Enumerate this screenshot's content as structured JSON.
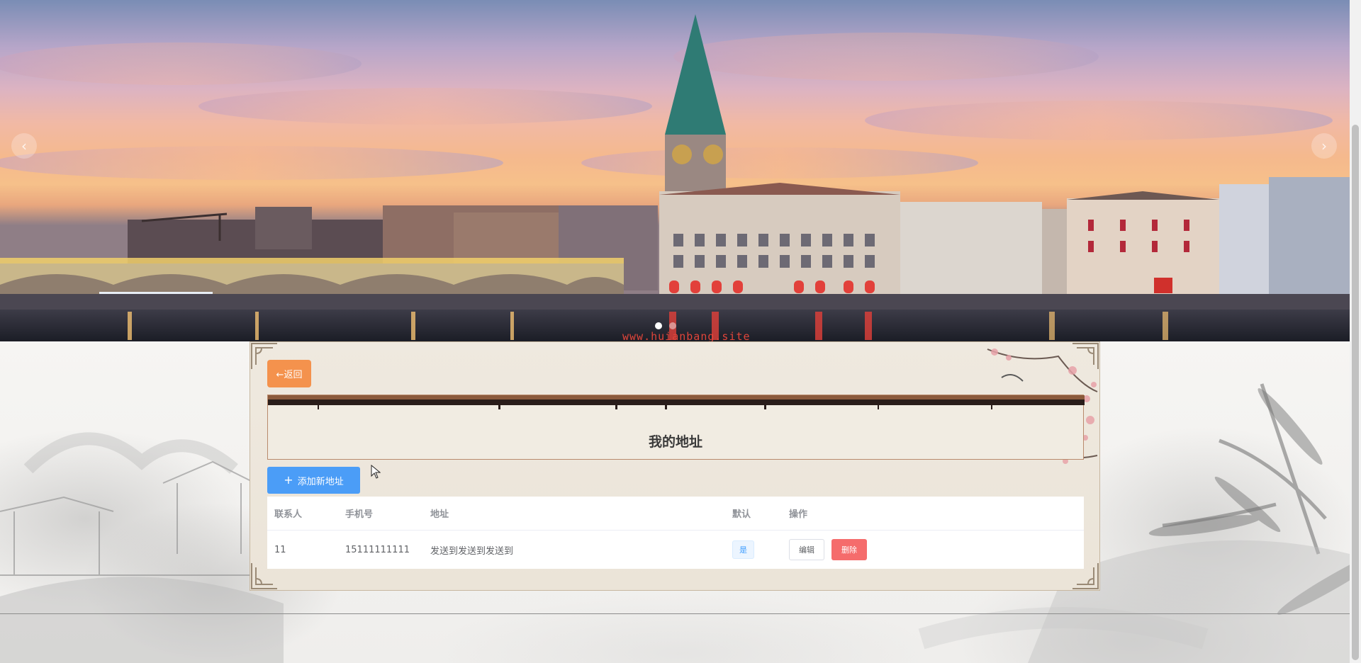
{
  "banner": {
    "watermark": "www.huianbang.site",
    "prev_arrow": "‹",
    "next_arrow": "›",
    "slide_count": 2,
    "active_slide": 1
  },
  "nav": {
    "back_label": "←返回"
  },
  "page": {
    "title": "我的地址",
    "add_button_label": "添加新地址",
    "add_button_icon": "plus-icon"
  },
  "table": {
    "headers": {
      "contact": "联系人",
      "phone": "手机号",
      "address": "地址",
      "default": "默认",
      "actions": "操作"
    },
    "rows": [
      {
        "contact": "11",
        "phone": "15111111111",
        "address": "发送到发送到发送到",
        "default": "是",
        "edit_label": "编辑",
        "delete_label": "删除"
      }
    ]
  },
  "colors": {
    "back_button": "#f4924d",
    "add_button": "#4b9df7",
    "delete_button": "#f56c6c",
    "watermark": "#e0453a"
  }
}
